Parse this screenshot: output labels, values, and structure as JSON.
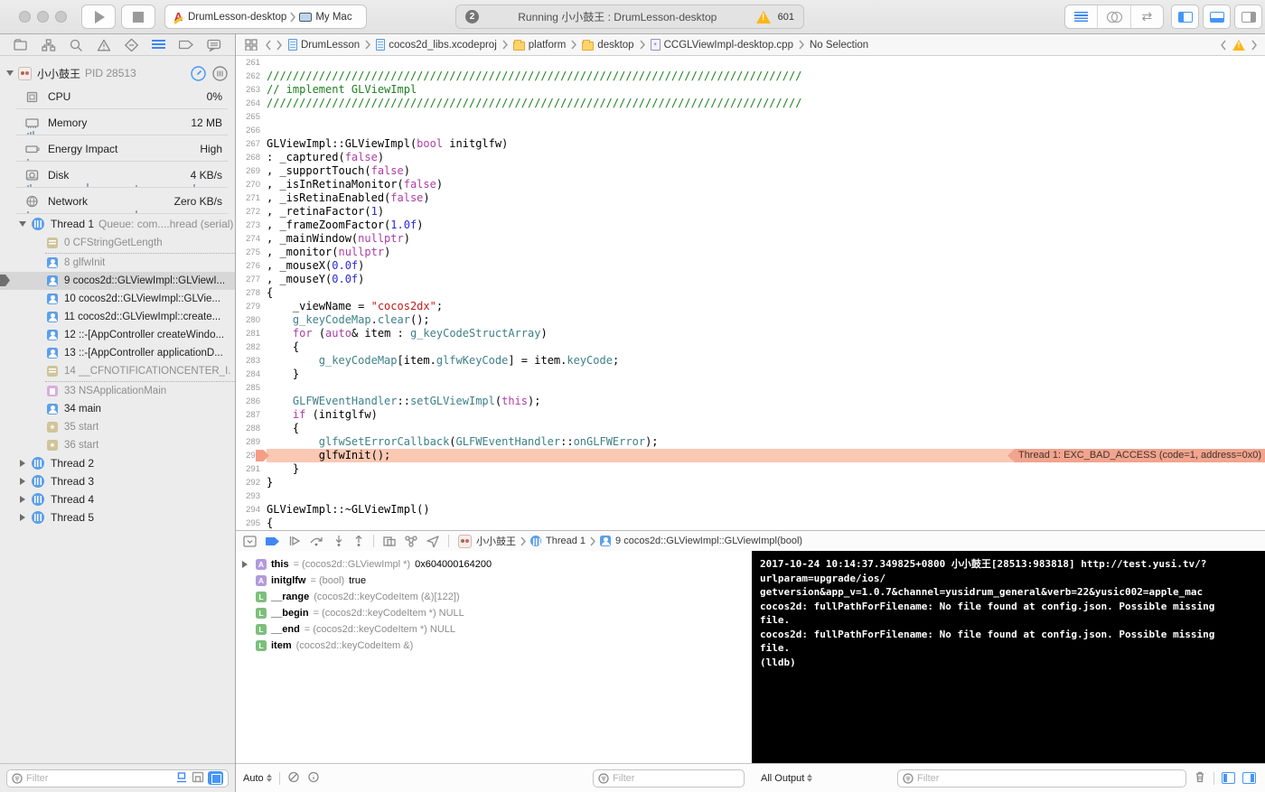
{
  "toolbar": {
    "scheme": "DrumLesson-desktop",
    "run_target": "My Mac",
    "status": {
      "tasks": "2",
      "text": "Running 小小鼓王 : DrumLesson-desktop",
      "warning_count": "601"
    }
  },
  "jumpbar": {
    "crumbs": [
      {
        "icon": "doc-blue",
        "label": "DrumLesson"
      },
      {
        "icon": "doc-blue",
        "label": "cocos2d_libs.xcodeproj"
      },
      {
        "icon": "folder-y",
        "label": "platform"
      },
      {
        "icon": "folder-y",
        "label": "desktop"
      },
      {
        "icon": "doc-cpp",
        "label": "CCGLViewImpl-desktop.cpp"
      },
      {
        "icon": "",
        "label": "No Selection"
      }
    ]
  },
  "sidebar": {
    "process": {
      "name": "小小鼓王",
      "pid": "PID 28513"
    },
    "gauges": [
      {
        "icon": "cpu",
        "label": "CPU",
        "value": "0%",
        "ticks": []
      },
      {
        "icon": "memory",
        "label": "Memory",
        "value": "12 MB",
        "ticks": [
          30,
          33,
          36
        ]
      },
      {
        "icon": "energy",
        "label": "Energy Impact",
        "value": "High",
        "ticks": [
          30
        ]
      },
      {
        "icon": "disk",
        "label": "Disk",
        "value": "4 KB/s",
        "ticks": [
          30,
          33,
          96,
          150,
          214
        ]
      },
      {
        "icon": "network",
        "label": "Network",
        "value": "Zero KB/s",
        "ticks": [
          30,
          150
        ]
      }
    ],
    "threads": [
      {
        "label": "Thread 1",
        "detail": "Queue: com....hread (serial)",
        "expanded": true,
        "frames": [
          {
            "icon": "sys",
            "label": "0 CFStringGetLength",
            "dim": true,
            "sep": true
          },
          {
            "icon": "user",
            "label": "8 glfwInit",
            "dim": true
          },
          {
            "icon": "user",
            "label": "9 cocos2d::GLViewImpl::GLViewI...",
            "selected": true
          },
          {
            "icon": "user",
            "label": "10 cocos2d::GLViewImpl::GLVie..."
          },
          {
            "icon": "user",
            "label": "11 cocos2d::GLViewImpl::create..."
          },
          {
            "icon": "user",
            "label": "12 ::-[AppController createWindo..."
          },
          {
            "icon": "user",
            "label": "13 ::-[AppController applicationD..."
          },
          {
            "icon": "sys",
            "label": "14 __CFNOTIFICATIONCENTER_I...",
            "dim": true,
            "sep": true
          },
          {
            "icon": "ns",
            "label": "33 NSApplicationMain",
            "dim": true
          },
          {
            "icon": "user",
            "label": "34 main"
          },
          {
            "icon": "gear",
            "label": "35 start",
            "dim": true
          },
          {
            "icon": "gear",
            "label": "36 start",
            "dim": true
          }
        ]
      },
      {
        "label": "Thread 2",
        "expanded": false,
        "frames": []
      },
      {
        "label": "Thread 3",
        "expanded": false,
        "frames": []
      },
      {
        "label": "Thread 4",
        "expanded": false,
        "frames": []
      },
      {
        "label": "Thread 5",
        "expanded": false,
        "frames": []
      }
    ],
    "filter_placeholder": "Filter"
  },
  "editor": {
    "crash_annotation": "Thread 1: EXC_BAD_ACCESS (code=1, address=0x0)",
    "lines": [
      {
        "n": 261,
        "tokens": []
      },
      {
        "n": 262,
        "tokens": [
          [
            "c",
            "//////////////////////////////////////////////////////////////////////////////////"
          ]
        ]
      },
      {
        "n": 263,
        "tokens": [
          [
            "c",
            "// implement GLViewImpl"
          ]
        ]
      },
      {
        "n": 264,
        "tokens": [
          [
            "c",
            "//////////////////////////////////////////////////////////////////////////////////"
          ]
        ]
      },
      {
        "n": 265,
        "tokens": []
      },
      {
        "n": 266,
        "tokens": []
      },
      {
        "n": 267,
        "tokens": [
          [
            "d",
            "GLViewImpl::GLViewImpl("
          ],
          [
            "k",
            "bool"
          ],
          [
            "d",
            " initglfw)"
          ]
        ]
      },
      {
        "n": 268,
        "tokens": [
          [
            "d",
            ": _captured("
          ],
          [
            "k",
            "false"
          ],
          [
            "d",
            ")"
          ]
        ]
      },
      {
        "n": 269,
        "tokens": [
          [
            "d",
            ", _supportTouch("
          ],
          [
            "k",
            "false"
          ],
          [
            "d",
            ")"
          ]
        ]
      },
      {
        "n": 270,
        "tokens": [
          [
            "d",
            ", _isInRetinaMonitor("
          ],
          [
            "k",
            "false"
          ],
          [
            "d",
            ")"
          ]
        ]
      },
      {
        "n": 271,
        "tokens": [
          [
            "d",
            ", _isRetinaEnabled("
          ],
          [
            "k",
            "false"
          ],
          [
            "d",
            ")"
          ]
        ]
      },
      {
        "n": 272,
        "tokens": [
          [
            "d",
            ", _retinaFactor("
          ],
          [
            "n",
            "1"
          ],
          [
            "d",
            ")"
          ]
        ]
      },
      {
        "n": 273,
        "tokens": [
          [
            "d",
            ", _frameZoomFactor("
          ],
          [
            "n",
            "1.0f"
          ],
          [
            "d",
            ")"
          ]
        ]
      },
      {
        "n": 274,
        "tokens": [
          [
            "d",
            ", _mainWindow("
          ],
          [
            "k",
            "nullptr"
          ],
          [
            "d",
            ")"
          ]
        ]
      },
      {
        "n": 275,
        "tokens": [
          [
            "d",
            ", _monitor("
          ],
          [
            "k",
            "nullptr"
          ],
          [
            "d",
            ")"
          ]
        ]
      },
      {
        "n": 276,
        "tokens": [
          [
            "d",
            ", _mouseX("
          ],
          [
            "n",
            "0.0f"
          ],
          [
            "d",
            ")"
          ]
        ]
      },
      {
        "n": 277,
        "tokens": [
          [
            "d",
            ", _mouseY("
          ],
          [
            "n",
            "0.0f"
          ],
          [
            "d",
            ")"
          ]
        ]
      },
      {
        "n": 278,
        "tokens": [
          [
            "d",
            "{"
          ]
        ]
      },
      {
        "n": 279,
        "tokens": [
          [
            "d",
            "    _viewName = "
          ],
          [
            "s",
            "\"cocos2dx\""
          ],
          [
            "d",
            ";"
          ]
        ]
      },
      {
        "n": 280,
        "tokens": [
          [
            "d",
            "    "
          ],
          [
            "t",
            "g_keyCodeMap"
          ],
          [
            "d",
            "."
          ],
          [
            "t",
            "clear"
          ],
          [
            "d",
            "();"
          ]
        ]
      },
      {
        "n": 281,
        "tokens": [
          [
            "d",
            "    "
          ],
          [
            "k",
            "for"
          ],
          [
            "d",
            " ("
          ],
          [
            "k",
            "auto"
          ],
          [
            "d",
            "& item : "
          ],
          [
            "t",
            "g_keyCodeStructArray"
          ],
          [
            "d",
            ")"
          ]
        ]
      },
      {
        "n": 282,
        "tokens": [
          [
            "d",
            "    {"
          ]
        ]
      },
      {
        "n": 283,
        "tokens": [
          [
            "d",
            "        "
          ],
          [
            "t",
            "g_keyCodeMap"
          ],
          [
            "d",
            "[item."
          ],
          [
            "t",
            "glfwKeyCode"
          ],
          [
            "d",
            "] = item."
          ],
          [
            "t",
            "keyCode"
          ],
          [
            "d",
            ";"
          ]
        ]
      },
      {
        "n": 284,
        "tokens": [
          [
            "d",
            "    }"
          ]
        ]
      },
      {
        "n": 285,
        "tokens": []
      },
      {
        "n": 286,
        "tokens": [
          [
            "d",
            "    "
          ],
          [
            "t",
            "GLFWEventHandler"
          ],
          [
            "d",
            "::"
          ],
          [
            "t",
            "setGLViewImpl"
          ],
          [
            "d",
            "("
          ],
          [
            "k",
            "this"
          ],
          [
            "d",
            ");"
          ]
        ]
      },
      {
        "n": 287,
        "tokens": [
          [
            "d",
            "    "
          ],
          [
            "k",
            "if"
          ],
          [
            "d",
            " (initglfw)"
          ]
        ]
      },
      {
        "n": 288,
        "tokens": [
          [
            "d",
            "    {"
          ]
        ]
      },
      {
        "n": 289,
        "tokens": [
          [
            "d",
            "        "
          ],
          [
            "t",
            "glfwSetErrorCallback"
          ],
          [
            "d",
            "("
          ],
          [
            "t",
            "GLFWEventHandler"
          ],
          [
            "d",
            "::"
          ],
          [
            "t",
            "onGLFWError"
          ],
          [
            "d",
            ");"
          ]
        ]
      },
      {
        "n": 290,
        "tokens": [
          [
            "d",
            "        glfwInit();"
          ]
        ],
        "crash": true
      },
      {
        "n": 291,
        "tokens": [
          [
            "d",
            "    }"
          ]
        ]
      },
      {
        "n": 292,
        "tokens": [
          [
            "d",
            "}"
          ]
        ]
      },
      {
        "n": 293,
        "tokens": []
      },
      {
        "n": 294,
        "tokens": [
          [
            "d",
            "GLViewImpl::~GLViewImpl()"
          ]
        ]
      },
      {
        "n": 295,
        "tokens": [
          [
            "d",
            "{"
          ]
        ]
      }
    ]
  },
  "debugbar": {
    "crumb": {
      "process": "小小鼓王",
      "thread": "Thread 1",
      "frame": "9 cocos2d::GLViewImpl::GLViewImpl(bool)"
    }
  },
  "variables": {
    "rows": [
      {
        "kind": "A",
        "expand": true,
        "name": "this",
        "type": "= (cocos2d::GLViewImpl *)",
        "value": "0x604000164200"
      },
      {
        "kind": "A",
        "name": "initglfw",
        "type": "= (bool)",
        "value": "true"
      },
      {
        "kind": "L",
        "name": "__range",
        "type": "(cocos2d::keyCodeItem (&)[122])",
        "value": ""
      },
      {
        "kind": "L",
        "name": "__begin",
        "type": "= (cocos2d::keyCodeItem *) NULL",
        "value": ""
      },
      {
        "kind": "L",
        "name": "__end",
        "type": "= (cocos2d::keyCodeItem *) NULL",
        "value": ""
      },
      {
        "kind": "L",
        "name": "item",
        "type": "(cocos2d::keyCodeItem &)",
        "value": ""
      }
    ],
    "scope_label": "Auto",
    "filter_placeholder": "Filter"
  },
  "console": {
    "lines": [
      "2017-10-24 10:14:37.349825+0800 小小鼓王[28513:983818] http://test.yusi.tv/?",
      "urlparam=upgrade/ios/",
      "getversion&app_v=1.0.7&channel=yusidrum_general&verb=22&yusic002=apple_mac",
      "cocos2d: fullPathForFilename: No file found at config.json. Possible missing",
      "file.",
      "cocos2d: fullPathForFilename: No file found at config.json. Possible missing",
      "file.",
      "(lldb)"
    ],
    "output_label": "All Output",
    "filter_placeholder": "Filter"
  }
}
